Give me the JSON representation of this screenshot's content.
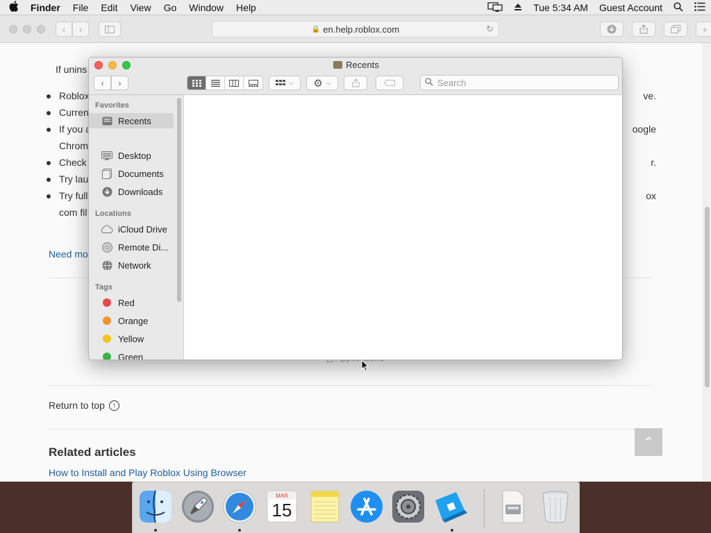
{
  "menubar": {
    "app": "Finder",
    "items": [
      "File",
      "Edit",
      "View",
      "Go",
      "Window",
      "Help"
    ],
    "time": "Tue 5:34 AM",
    "user": "Guest Account"
  },
  "safari": {
    "address": "en.help.roblox.com"
  },
  "page": {
    "intro": "If unins",
    "bullets": [
      {
        "left": "Roblox",
        "right": "ve."
      },
      {
        "left": "Curren",
        "right": ""
      },
      {
        "left": "If you a",
        "right": "oogle"
      },
      {
        "left": "Chrom",
        "right": ""
      },
      {
        "left": "Check",
        "right": "r."
      },
      {
        "left": "Try lau",
        "right": ""
      },
      {
        "left": "Try full",
        "right": "ox"
      },
      {
        "left": "com fil",
        "right": ""
      }
    ],
    "need_more": "Need mo",
    "ghost_text": "Applications",
    "return_top": "Return to top",
    "related_heading": "Related articles",
    "related_link": "How to Install and Play Roblox Using Browser"
  },
  "finder": {
    "title": "Recents",
    "search_placeholder": "Search",
    "sidebar": {
      "favorites_header": "Favorites",
      "favorites": [
        "Recents",
        "Desktop",
        "Documents",
        "Downloads"
      ],
      "locations_header": "Locations",
      "locations": [
        "iCloud Drive",
        "Remote Di...",
        "Network"
      ],
      "tags_header": "Tags",
      "tags": [
        {
          "label": "Red",
          "color": "#e5484d"
        },
        {
          "label": "Orange",
          "color": "#f0932b"
        },
        {
          "label": "Yellow",
          "color": "#f5c518"
        },
        {
          "label": "Green",
          "color": "#38b249"
        }
      ]
    }
  },
  "calendar": {
    "month": "MAR",
    "day": "15"
  },
  "dock": {
    "apps": [
      "finder-app",
      "launchpad-app",
      "safari-app",
      "calendar-app",
      "notes-app",
      "app-store-app",
      "system-preferences-app",
      "roblox-studio-app",
      "disk-image-file",
      "trash"
    ]
  }
}
